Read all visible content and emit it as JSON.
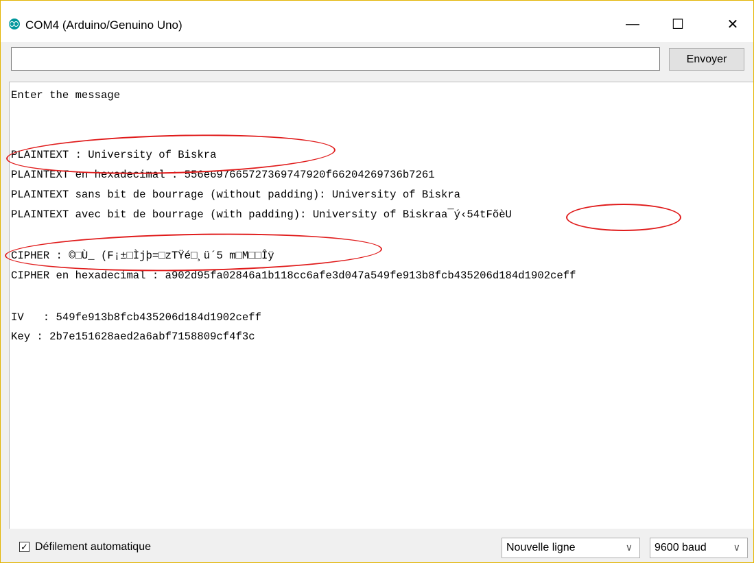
{
  "window": {
    "title": "COM4 (Arduino/Genuino Uno)",
    "controls": {
      "minimize": "—",
      "maximize": "☐",
      "close": "✕"
    }
  },
  "send": {
    "input_value": "",
    "button_label": "Envoyer"
  },
  "console": {
    "lines": [
      "Enter the message",
      "",
      "",
      "PLAINTEXT : University of Biskra",
      "PLAINTEXT en hexadecimal : 556e697665727369747920f66204269736b7261",
      "PLAINTEXT sans bit de bourrage (without padding): University of Biskra",
      "PLAINTEXT avec bit de bourrage (with padding): University of Biskraa¯ý‹54tFõèU",
      "",
      "CIPHER : ©□Ù_ (F¡±□Ìjþ=□zTŸé□¸ü´5 m□M□□Îÿ",
      "CIPHER en hexadecimal : a902d95fa02846a1b118cc6afe3d047a549fe913b8fcb435206d184d1902ceff",
      "",
      "IV   : 549fe913b8fcb435206d184d1902ceff",
      "Key : 2b7e151628aed2a6abf7158809cf4f3c"
    ]
  },
  "footer": {
    "autoscroll_checked": true,
    "autoscroll_label": "Défilement automatique",
    "line_ending": "Nouvelle ligne",
    "baud": "9600 baud"
  },
  "colors": {
    "annotation": "#e01b1b",
    "app_icon": "#00979c"
  },
  "icons": {
    "app": "arduino-icon",
    "dropdown": "chevron-down-icon",
    "checkbox": "checkmark-icon"
  }
}
